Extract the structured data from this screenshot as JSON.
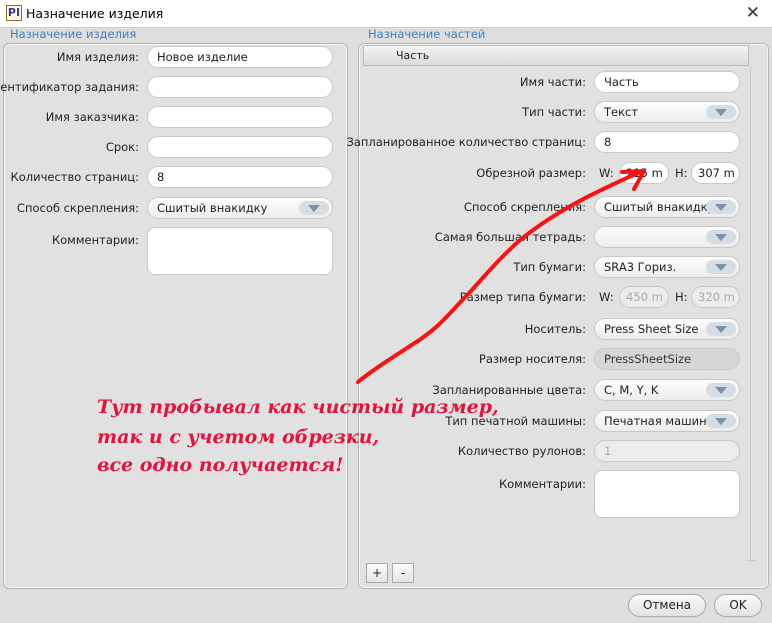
{
  "window": {
    "title": "Назначение изделия",
    "icon_text": "PI",
    "close": "✕"
  },
  "left": {
    "group_label": "Назначение изделия",
    "fields": [
      {
        "label": "Имя изделия:",
        "value": "Новое изделие"
      },
      {
        "label": "Идентификатор задания:",
        "value": ""
      },
      {
        "label": "Имя заказчика:",
        "value": ""
      },
      {
        "label": "Срок:",
        "value": ""
      },
      {
        "label": "Количество страниц:",
        "value": "8"
      },
      {
        "label": "Способ скрепления:",
        "value": "Сшитый внакидку"
      }
    ],
    "comments_label": "Комментарии:"
  },
  "right": {
    "group_label": "Назначение частей",
    "tab": "Часть",
    "part_name": {
      "label": "Имя части:",
      "value": "Часть"
    },
    "part_type": {
      "label": "Тип части:",
      "value": "Текст"
    },
    "planned_pages": {
      "label": "Запланированное количество страниц:",
      "value": "8"
    },
    "trim_size": {
      "label": "Обрезной размер:",
      "w_label": "W:",
      "w": "215 m",
      "h_label": "H:",
      "h": "307 m"
    },
    "binding": {
      "label": "Способ скрепления:",
      "value": "Сшитый внакидку"
    },
    "largest_signature": {
      "label": "Самая большая тетрадь:",
      "value": ""
    },
    "paper_type": {
      "label": "Тип бумаги:",
      "value": "SRA3 Гориз."
    },
    "paper_size": {
      "label": "Размер типа бумаги:",
      "w_label": "W:",
      "w": "450 m",
      "h_label": "H:",
      "h": "320 m"
    },
    "media": {
      "label": "Носитель:",
      "value": "Press Sheet Size"
    },
    "media_size": {
      "label": "Размер носителя:",
      "value": "PressSheetSize"
    },
    "planned_colors": {
      "label": "Запланированные цвета:",
      "value": "C, M, Y, K"
    },
    "press_type": {
      "label": "Тип печатной машины:",
      "value": "Печатная машина"
    },
    "rolls": {
      "label": "Количество рулонов:",
      "value": "1"
    },
    "comments_label": "Комментарии:",
    "add": "+",
    "remove": "-"
  },
  "buttons": {
    "cancel": "Отмена",
    "ok": "OK"
  },
  "annotation": {
    "lines": [
      "Тут пробывал как чистый размер,",
      "так и с учетом обрезки,",
      "все одно получается!"
    ],
    "color": "#e8103c"
  }
}
